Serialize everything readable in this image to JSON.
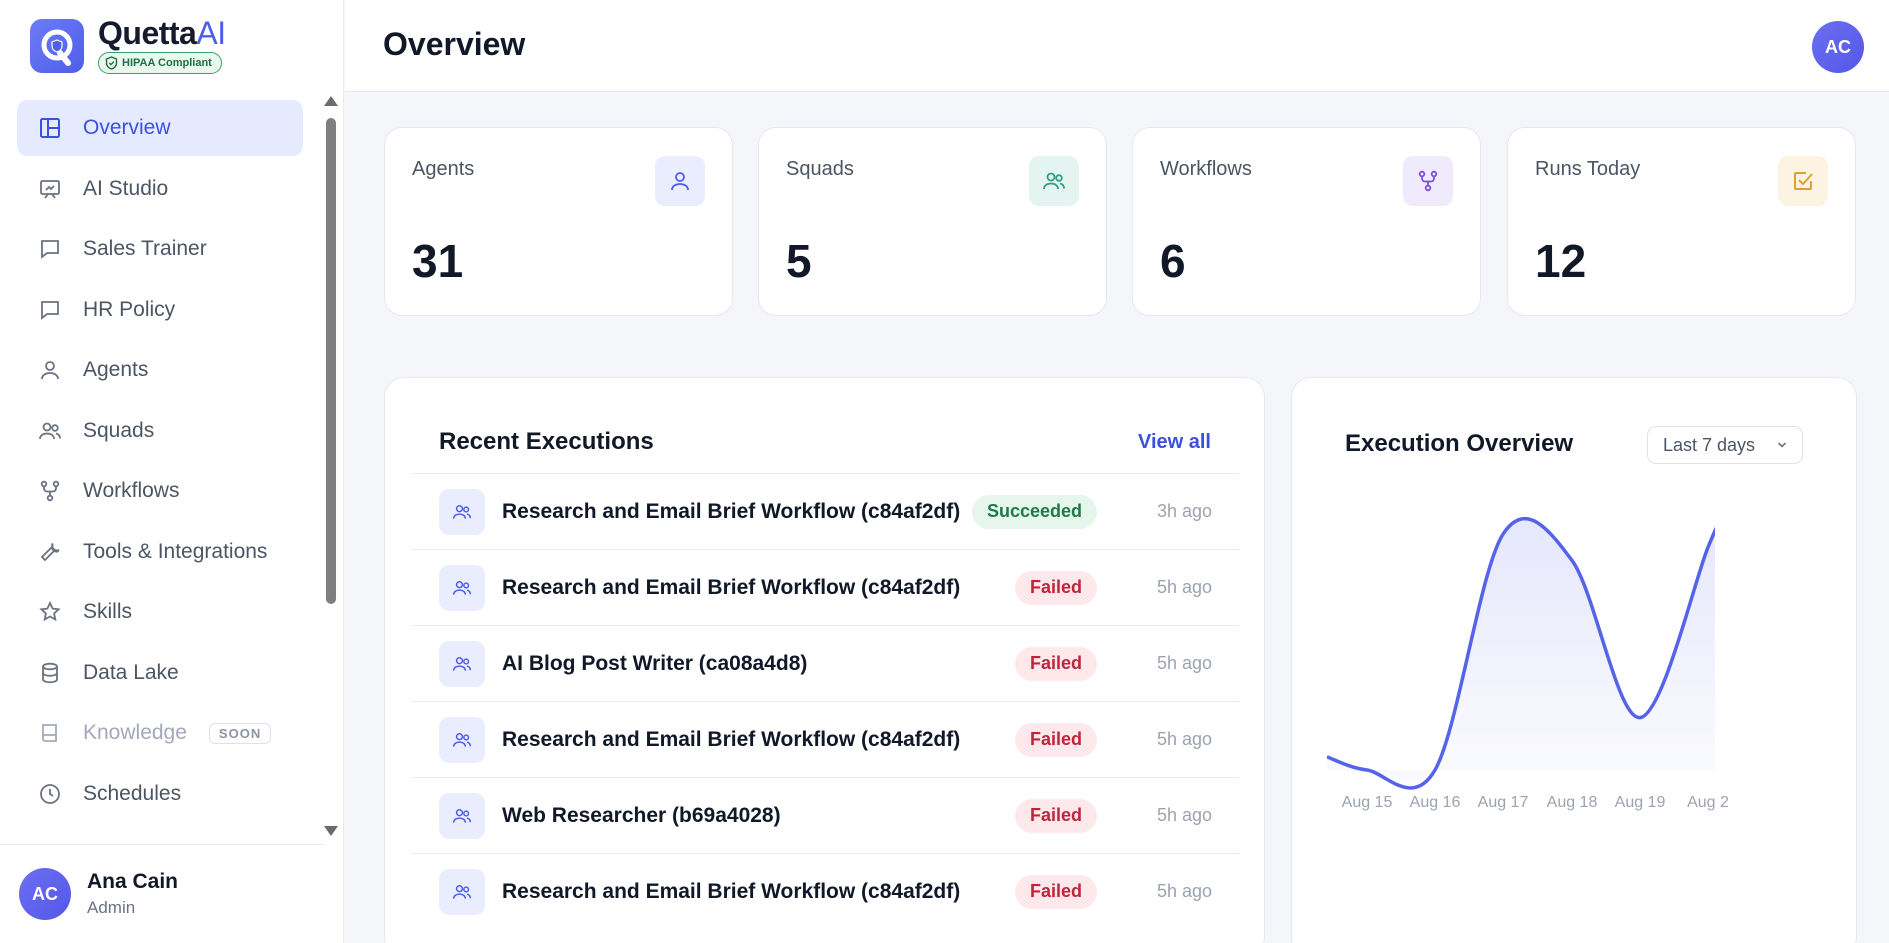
{
  "brand": {
    "name": "Quetta",
    "name_ai": "AI",
    "badge": "HIPAA Compliant"
  },
  "sidebar": {
    "items": [
      {
        "label": "Overview",
        "icon": "layout-icon",
        "state": "active"
      },
      {
        "label": "AI Studio",
        "icon": "presentation-icon"
      },
      {
        "label": "Sales Trainer",
        "icon": "chat-icon"
      },
      {
        "label": "HR Policy",
        "icon": "chat-icon"
      },
      {
        "label": "Agents",
        "icon": "user-icon"
      },
      {
        "label": "Squads",
        "icon": "users-icon"
      },
      {
        "label": "Workflows",
        "icon": "git-fork-icon"
      },
      {
        "label": "Tools & Integrations",
        "icon": "wrench-icon"
      },
      {
        "label": "Skills",
        "icon": "star-icon"
      },
      {
        "label": "Data Lake",
        "icon": "database-icon"
      },
      {
        "label": "Knowledge",
        "icon": "book-icon",
        "state": "disabled",
        "tag": "SOON"
      },
      {
        "label": "Schedules",
        "icon": "clock-icon"
      }
    ]
  },
  "user": {
    "initials": "AC",
    "name": "Ana Cain",
    "role": "Admin"
  },
  "header": {
    "title": "Overview",
    "avatar_initials": "AC"
  },
  "stats": [
    {
      "label": "Agents",
      "value": "31",
      "icon": "user-icon",
      "color": "#4f5ee8",
      "bg": "#eaedfd"
    },
    {
      "label": "Squads",
      "value": "5",
      "icon": "users-icon",
      "color": "#2f9e8a",
      "bg": "#e4f5f1"
    },
    {
      "label": "Workflows",
      "value": "6",
      "icon": "git-fork-icon",
      "color": "#7c4ddb",
      "bg": "#f0eafd"
    },
    {
      "label": "Runs Today",
      "value": "12",
      "icon": "check-square-icon",
      "color": "#e0a030",
      "bg": "#fdf3e2"
    }
  ],
  "recent": {
    "title": "Recent Executions",
    "view_all": "View all",
    "rows": [
      {
        "name": "Research and Email Brief Workflow (c84af2df)",
        "status": "Succeeded",
        "time": "3h ago"
      },
      {
        "name": "Research and Email Brief Workflow (c84af2df)",
        "status": "Failed",
        "time": "5h ago"
      },
      {
        "name": "AI Blog Post Writer (ca08a4d8)",
        "status": "Failed",
        "time": "5h ago"
      },
      {
        "name": "Research and Email Brief Workflow (c84af2df)",
        "status": "Failed",
        "time": "5h ago"
      },
      {
        "name": "Web Researcher (b69a4028)",
        "status": "Failed",
        "time": "5h ago"
      },
      {
        "name": "Research and Email Brief Workflow (c84af2df)",
        "status": "Failed",
        "time": "5h ago"
      }
    ]
  },
  "overview": {
    "title": "Execution Overview",
    "range": "Last 7 days",
    "colors": {
      "line": "#5562ea",
      "fill": "#e4e6fb"
    }
  },
  "chart_data": {
    "type": "area",
    "categories": [
      "Aug 15",
      "Aug 16",
      "Aug 17",
      "Aug 18",
      "Aug 19",
      "Aug 2"
    ],
    "values": [
      0,
      0,
      9,
      8,
      2,
      8.5
    ],
    "ylim": [
      0,
      10
    ],
    "grid": false
  }
}
